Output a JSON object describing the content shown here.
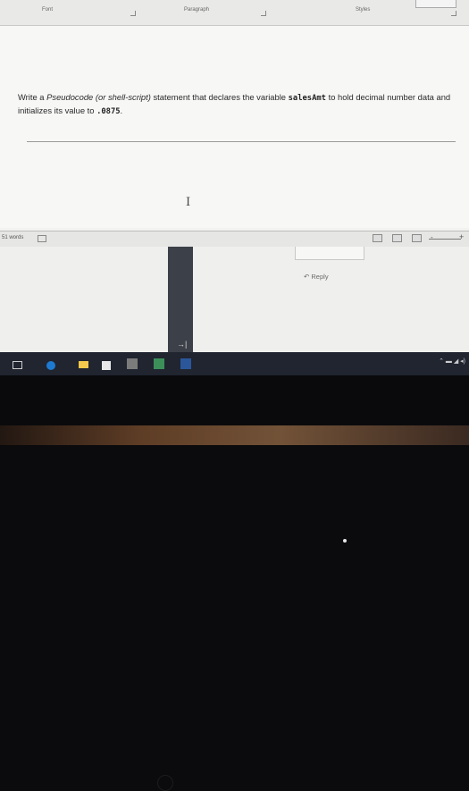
{
  "ribbon": {
    "groups": [
      "Font",
      "Paragraph",
      "Styles"
    ]
  },
  "question": {
    "part1": "Write a ",
    "pseudo": "Pseudocode",
    "italic": " (or shell-script)",
    "part2": " statement that declares the variable ",
    "var": "salesAmt",
    "part3": " to hold decimal number data and initializes its value to ",
    "value": ".0875",
    "end": "."
  },
  "status": {
    "words": "51 words"
  },
  "comment": {
    "reply_label": "Reply"
  },
  "taskbar": {
    "apps": [
      "task-view-icon",
      "edge-icon",
      "file-explorer-icon",
      "store-icon",
      "amazon-icon",
      "photos-icon",
      "word-icon"
    ],
    "colors": {
      "edge": "#1e7ad1",
      "word": "#2b579a",
      "explorer": "#f2c94c",
      "store": "#e8e8e8",
      "amazon": "#7b7b7b",
      "photos": "#3d8f5a"
    }
  }
}
